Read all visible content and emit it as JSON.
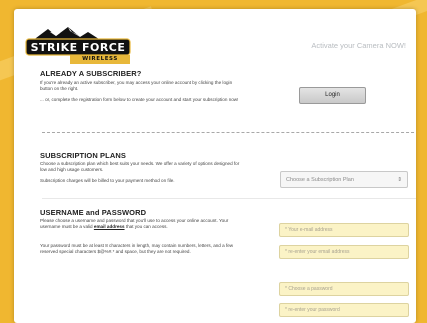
{
  "header": {
    "logo_text": "STRIKE FORCE",
    "logo_subtext": "WIRELESS",
    "activate_text": "Activate your Camera NOW!"
  },
  "subscriber": {
    "title": "ALREADY A SUBSCRIBER?",
    "text1": "If you're already an active subscriber, you may access your online account by clicking the login button on the right.",
    "text2": "... or, complete the registration form below to create your account and start your subscription now!",
    "login_label": "Login"
  },
  "plans": {
    "title": "SUBSCRIPTION PLANS",
    "text1": "Choose a subscription plan which best suits your needs. We offer a variety of options designed for low and high usage customers.",
    "text2": "Subscription charges will be billed to your payment method on file.",
    "select_placeholder": "Choose a Subscription Plan",
    "select_arrows": "⇕"
  },
  "credentials": {
    "title": "USERNAME and PASSWORD",
    "text1_pre": "Please choose a username and password that you'll use to access your online account. Your username must be a valid ",
    "text1_link": "email address",
    "text1_post": " that you can access.",
    "text2": "Your password must be at least 8 characters in length, may contain numbers, letters, and a few reserved special characters $@%#.* and space, but they are not required.",
    "email_placeholder": "* Your e-mail address",
    "email_confirm_placeholder": "* re-enter your email address",
    "password_placeholder": "* Choose a password",
    "password_confirm_placeholder": "* re-enter your password"
  },
  "colors": {
    "background": "#f0b730",
    "logo_bar": "#e8b83a",
    "input_fill": "#fbf3c6"
  }
}
